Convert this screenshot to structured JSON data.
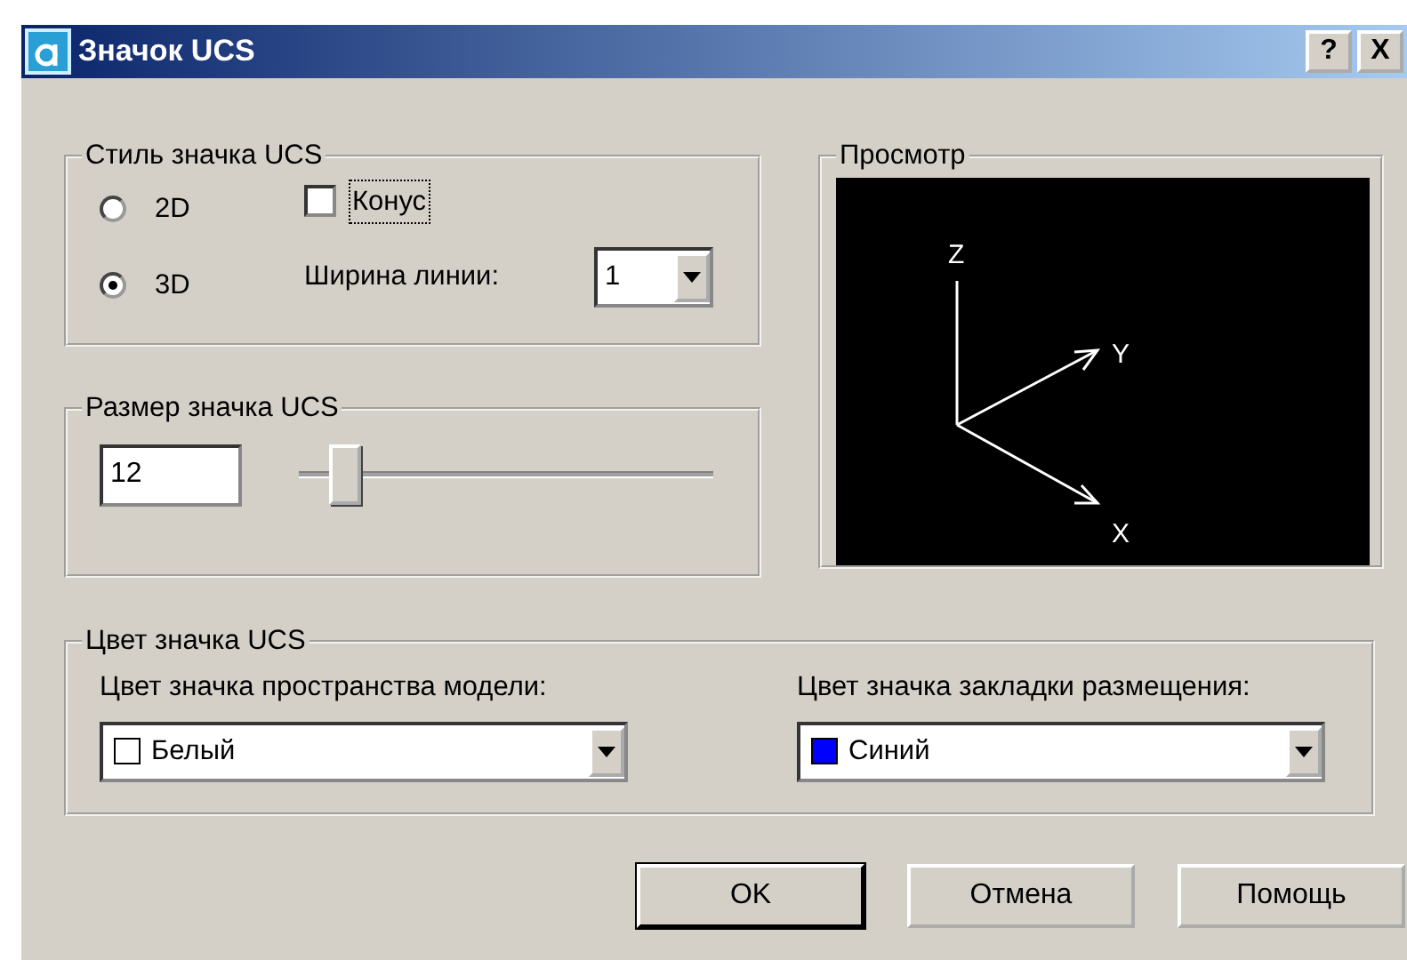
{
  "window": {
    "title": "Значок UCS",
    "title_buttons": [
      "?",
      "X"
    ]
  },
  "style_group": {
    "title": "Стиль значка UCS",
    "modes": [
      {
        "label": "2D",
        "selected": false
      },
      {
        "label": "3D",
        "selected": true
      }
    ],
    "cone": {
      "label": "Конус",
      "checked": false,
      "focused": true
    },
    "line_width": {
      "label": "Ширина линии:",
      "value": "1"
    }
  },
  "size_group": {
    "title": "Размер значка UCS",
    "value": "12",
    "slider": {
      "level": 0.11
    }
  },
  "preview": {
    "title": "Просмотр",
    "axes": [
      "Z",
      "Y",
      "X"
    ]
  },
  "color_group": {
    "title": "Цвет значка UCS",
    "fields": [
      {
        "label": "Цвет значка пространства модели:",
        "value": "Белый",
        "color": "#ffffff"
      },
      {
        "label": "Цвет значка закладки размещения:",
        "value": "Синий",
        "color": "#0000ff"
      }
    ]
  },
  "buttons": [
    {
      "label": "OK",
      "default": true
    },
    {
      "label": "Отмена",
      "default": false
    },
    {
      "label": "Помощь",
      "default": false
    }
  ]
}
